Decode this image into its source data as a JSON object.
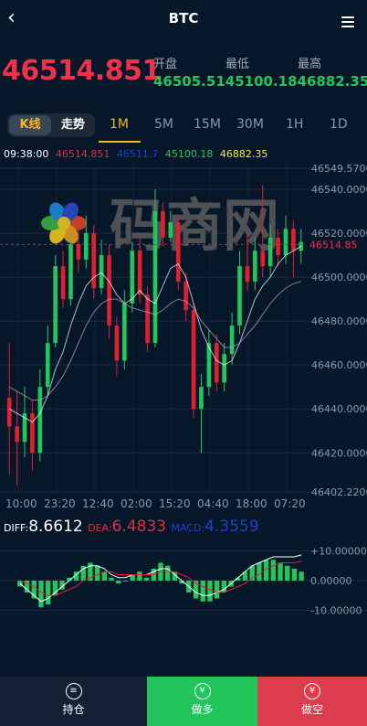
{
  "header": {
    "back_icon": "chevron-left-icon",
    "title": "BTC",
    "menu_icon": "hamburger-menu-icon"
  },
  "quote": {
    "current_price": "46514.851",
    "open_label": "开盘",
    "low_label": "最低",
    "high_label": "最高",
    "open": "46505.514",
    "low": "5100.18",
    "high": "46882.35",
    "price_color": "#f0314a",
    "stat_color": "#22c65c"
  },
  "mode_toggle": {
    "kline_label": "K线",
    "trend_label": "走势"
  },
  "periods": [
    "1M",
    "5M",
    "15M",
    "30M",
    "1H",
    "1D"
  ],
  "active_period": "1M",
  "ma_legend": {
    "time": "09:38:00",
    "v1": "46514.851",
    "v2": "46511.7",
    "v3": "45100.18",
    "v4": "46882.35"
  },
  "kline_axis": {
    "price_ticks": [
      "46549.5700",
      "46540.0000",
      "46520.0000",
      "46500.0000",
      "46480.0000",
      "46460.0000",
      "46440.0000",
      "46420.0000",
      "46402.2200"
    ],
    "current_price_marker": "46514.85",
    "time_ticks": [
      "10:00",
      "23:20",
      "12:40",
      "02:00",
      "15:20",
      "04:40",
      "18:00",
      "07:20"
    ]
  },
  "indicator_legend": {
    "diff_label": "DIFF:",
    "diff_value": "8.6612",
    "dea_label": "DEA:",
    "dea_value": "6.4833",
    "macd_label": "MACD:",
    "macd_value": "4.3559"
  },
  "macd_axis": {
    "ticks": [
      "+10.00000",
      "0.00000",
      "-10.00000"
    ]
  },
  "watermark": {
    "text": "码商网"
  },
  "bottom_bar": {
    "hold_label": "持仓",
    "hold_icon": "coins-icon",
    "buy_label": "做多",
    "buy_icon": "yuan-up-icon",
    "sell_label": "做空",
    "sell_icon": "yuan-down-icon",
    "buy_color": "#21c55c",
    "sell_color": "#dd3e4e"
  },
  "chart_data": {
    "type": "candlestick",
    "y_range": [
      46402.22,
      46549.57
    ],
    "x_labels": [
      "10:00",
      "23:20",
      "12:40",
      "02:00",
      "15:20",
      "04:40",
      "18:00",
      "07:20"
    ],
    "candles": [
      {
        "o": 46445,
        "c": 46432,
        "h": 46470,
        "l": 46410
      },
      {
        "o": 46432,
        "c": 46425,
        "h": 46448,
        "l": 46405
      },
      {
        "o": 46425,
        "c": 46438,
        "h": 46450,
        "l": 46418
      },
      {
        "o": 46438,
        "c": 46420,
        "h": 46444,
        "l": 46412
      },
      {
        "o": 46420,
        "c": 46450,
        "h": 46458,
        "l": 46416
      },
      {
        "o": 46450,
        "c": 46470,
        "h": 46478,
        "l": 46446
      },
      {
        "o": 46470,
        "c": 46505,
        "h": 46510,
        "l": 46468
      },
      {
        "o": 46505,
        "c": 46490,
        "h": 46512,
        "l": 46486
      },
      {
        "o": 46490,
        "c": 46515,
        "h": 46520,
        "l": 46487
      },
      {
        "o": 46515,
        "c": 46508,
        "h": 46525,
        "l": 46502
      },
      {
        "o": 46508,
        "c": 46520,
        "h": 46528,
        "l": 46504
      },
      {
        "o": 46520,
        "c": 46495,
        "h": 46524,
        "l": 46490
      },
      {
        "o": 46495,
        "c": 46510,
        "h": 46517,
        "l": 46492
      },
      {
        "o": 46510,
        "c": 46478,
        "h": 46515,
        "l": 46472
      },
      {
        "o": 46478,
        "c": 46462,
        "h": 46482,
        "l": 46455
      },
      {
        "o": 46462,
        "c": 46488,
        "h": 46494,
        "l": 46458
      },
      {
        "o": 46488,
        "c": 46512,
        "h": 46516,
        "l": 46484
      },
      {
        "o": 46512,
        "c": 46492,
        "h": 46518,
        "l": 46488
      },
      {
        "o": 46492,
        "c": 46470,
        "h": 46496,
        "l": 46466
      },
      {
        "o": 46470,
        "c": 46530,
        "h": 46540,
        "l": 46468
      },
      {
        "o": 46530,
        "c": 46518,
        "h": 46534,
        "l": 46514
      },
      {
        "o": 46518,
        "c": 46525,
        "h": 46530,
        "l": 46516
      },
      {
        "o": 46525,
        "c": 46498,
        "h": 46528,
        "l": 46494
      },
      {
        "o": 46498,
        "c": 46485,
        "h": 46502,
        "l": 46480
      },
      {
        "o": 46485,
        "c": 46440,
        "h": 46488,
        "l": 46436
      },
      {
        "o": 46440,
        "c": 46450,
        "h": 46456,
        "l": 46420
      },
      {
        "o": 46450,
        "c": 46470,
        "h": 46476,
        "l": 46446
      },
      {
        "o": 46470,
        "c": 46452,
        "h": 46474,
        "l": 46448
      },
      {
        "o": 46452,
        "c": 46465,
        "h": 46470,
        "l": 46448
      },
      {
        "o": 46465,
        "c": 46478,
        "h": 46484,
        "l": 46460
      },
      {
        "o": 46478,
        "c": 46505,
        "h": 46512,
        "l": 46474
      },
      {
        "o": 46505,
        "c": 46498,
        "h": 46520,
        "l": 46494
      },
      {
        "o": 46498,
        "c": 46512,
        "h": 46518,
        "l": 46494
      },
      {
        "o": 46512,
        "c": 46505,
        "h": 46542,
        "l": 46500
      },
      {
        "o": 46505,
        "c": 46518,
        "h": 46524,
        "l": 46500
      },
      {
        "o": 46518,
        "c": 46510,
        "h": 46522,
        "l": 46505
      },
      {
        "o": 46510,
        "c": 46522,
        "h": 46528,
        "l": 46506
      },
      {
        "o": 46522,
        "c": 46512,
        "h": 46526,
        "l": 46500
      },
      {
        "o": 46512,
        "c": 46516,
        "h": 46522,
        "l": 46506
      }
    ],
    "ma_lines": [
      {
        "values": [
          46440,
          46438,
          46436,
          46434,
          46438,
          46446,
          46458,
          46466,
          46478,
          46488,
          46496,
          46500,
          46502,
          46498,
          46492,
          46488,
          46490,
          46494,
          46490,
          46488,
          46496,
          46504,
          46506,
          46500,
          46488,
          46476,
          46468,
          46462,
          46460,
          46462,
          46470,
          46480,
          46490,
          46496,
          46500,
          46506,
          46510,
          46512,
          46514
        ],
        "color": "#ffffff"
      },
      {
        "values": [
          46450,
          46448,
          46446,
          46444,
          46444,
          46446,
          46450,
          46455,
          46462,
          46470,
          46478,
          46484,
          46488,
          46490,
          46490,
          46488,
          46486,
          46485,
          46484,
          46483,
          46485,
          46488,
          46490,
          46489,
          46486,
          46480,
          46476,
          46472,
          46468,
          46468,
          46470,
          46474,
          46478,
          46483,
          46488,
          46492,
          46495,
          46497,
          46498
        ],
        "color": "#c0a9b8"
      }
    ],
    "macd": {
      "hist": [
        -2,
        -4,
        -6,
        -9,
        -8,
        -5,
        -3,
        1,
        3,
        5,
        6,
        5,
        3,
        1,
        -1,
        0,
        2,
        3,
        1,
        4,
        6,
        5,
        3,
        -1,
        -4,
        -6,
        -7,
        -7,
        -6,
        -4,
        -2,
        1,
        3,
        5,
        6,
        7,
        7,
        6,
        5,
        4,
        3
      ],
      "diff": [
        -1,
        -3,
        -5,
        -7,
        -6,
        -4,
        -2,
        0,
        2,
        4,
        5,
        5,
        4,
        2,
        1,
        1,
        2,
        2,
        2,
        3,
        4,
        4,
        2,
        0,
        -2,
        -4,
        -5,
        -5,
        -4,
        -3,
        -1,
        1,
        3,
        5,
        6,
        7,
        8,
        8,
        8,
        8,
        8.6612
      ],
      "dea": [
        0,
        -1,
        -2,
        -4,
        -5,
        -5,
        -4,
        -3,
        -2,
        0,
        1,
        2,
        3,
        3,
        2,
        2,
        2,
        2,
        2,
        2,
        3,
        3,
        3,
        2,
        1,
        -1,
        -2,
        -3,
        -4,
        -4,
        -3,
        -2,
        -1,
        1,
        2,
        4,
        5,
        6,
        6,
        6,
        6.4833
      ],
      "range": [
        -12,
        12
      ]
    }
  }
}
